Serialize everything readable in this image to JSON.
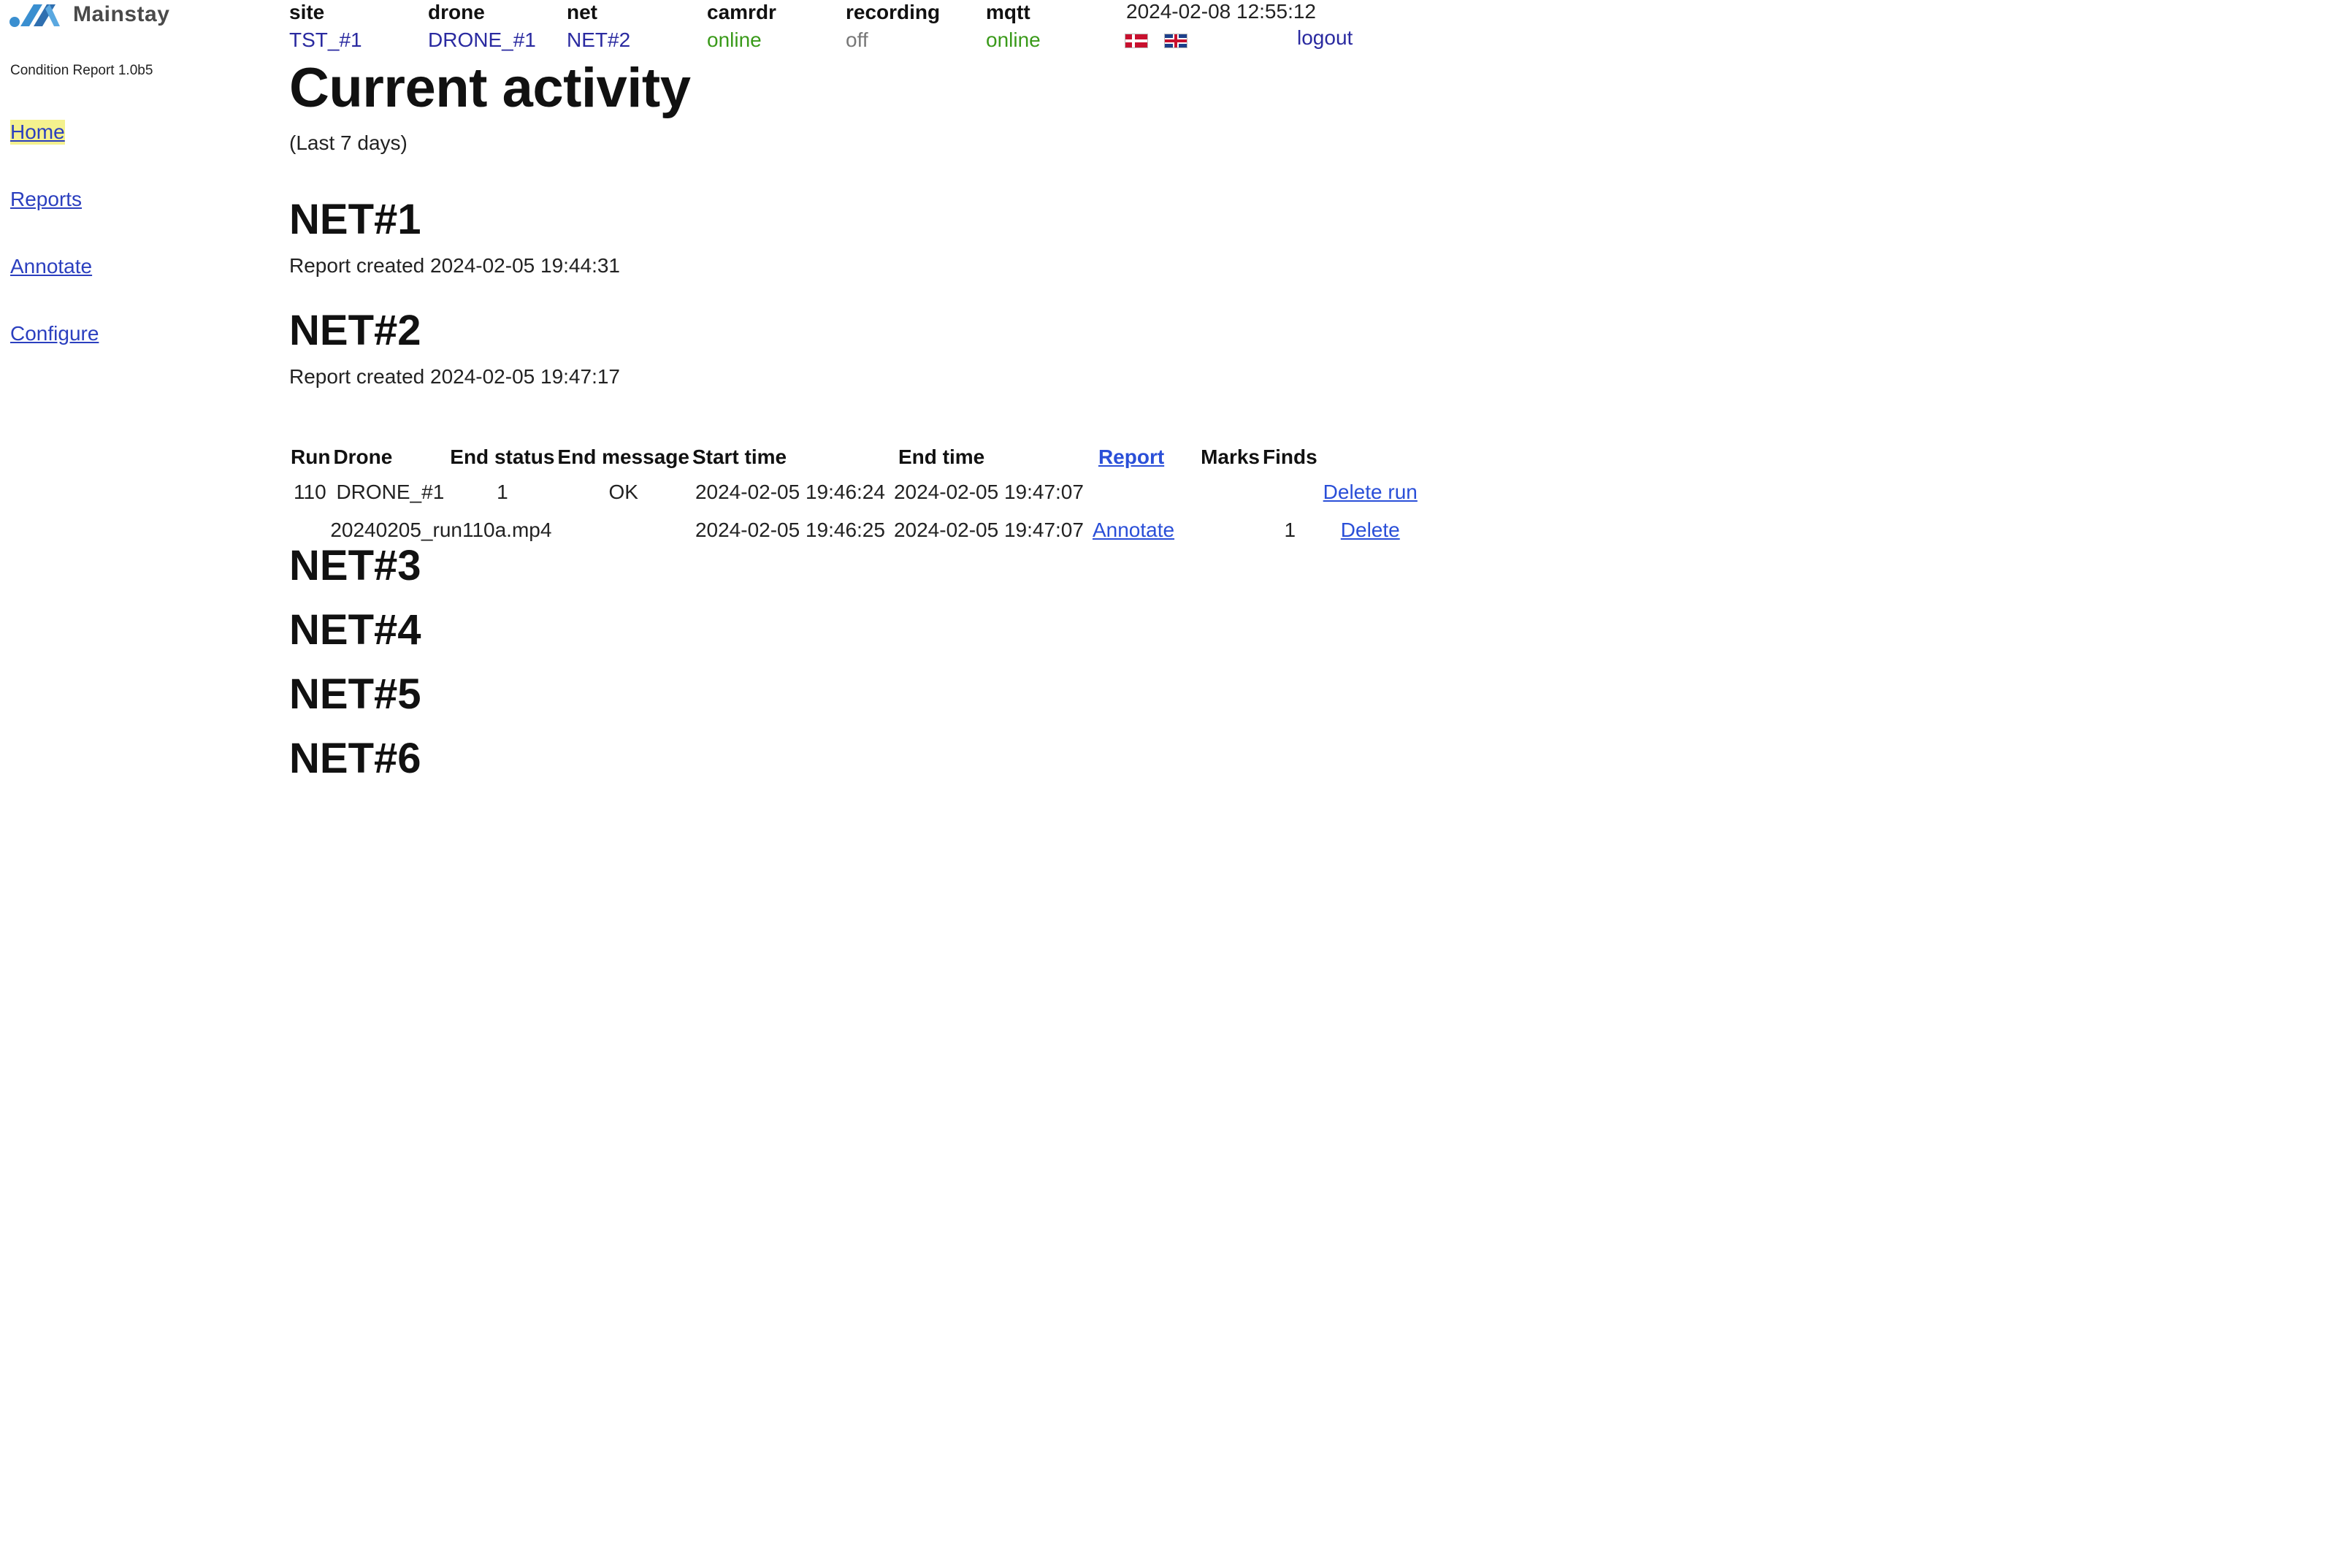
{
  "brand": {
    "name": "Mainstay",
    "version": "Condition Report 1.0b5",
    "accent": "#3a8fd0"
  },
  "nav": {
    "items": [
      {
        "label": "Home",
        "active": true
      },
      {
        "label": "Reports"
      },
      {
        "label": "Annotate"
      },
      {
        "label": "Configure"
      }
    ]
  },
  "status": {
    "site": {
      "label": "site",
      "value": "TST_#1"
    },
    "drone": {
      "label": "drone",
      "value": "DRONE_#1"
    },
    "net": {
      "label": "net",
      "value": "NET#2"
    },
    "camrdr": {
      "label": "camrdr",
      "value": "online",
      "color": "#3a9a1a"
    },
    "recording": {
      "label": "recording",
      "value": "off",
      "color": "#777777"
    },
    "mqtt": {
      "label": "mqtt",
      "value": "online",
      "color": "#3a9a1a"
    },
    "datetime": "2024-02-08 12:55:12",
    "flags": [
      "flag-norway-icon",
      "flag-uk-icon"
    ],
    "logout": "logout"
  },
  "main": {
    "title": "Current activity",
    "subtitle": "(Last 7 days)",
    "nets": [
      {
        "name": "NET#1",
        "created": "Report created 2024-02-05 19:44:31"
      },
      {
        "name": "NET#2",
        "created": "Report created 2024-02-05 19:47:17"
      },
      {
        "name": "NET#3"
      },
      {
        "name": "NET#4"
      },
      {
        "name": "NET#5"
      },
      {
        "name": "NET#6"
      }
    ],
    "table": {
      "headers": [
        "Run",
        "Drone",
        "End status",
        "End message",
        "Start time",
        "End time",
        "Report",
        "Marks",
        "Finds"
      ],
      "run_row": {
        "run": "110",
        "drone": "DRONE_#1",
        "end_status": "1",
        "end_message": "OK",
        "start_time": "2024-02-05 19:46:24",
        "end_time": "2024-02-05 19:47:07",
        "action": "Delete run"
      },
      "file_row": {
        "file": "20240205_run110a.mp4",
        "start_time": "2024-02-05 19:46:25",
        "end_time": "2024-02-05 19:47:07",
        "annotate": "Annotate",
        "finds": "1",
        "action": "Delete"
      }
    }
  }
}
